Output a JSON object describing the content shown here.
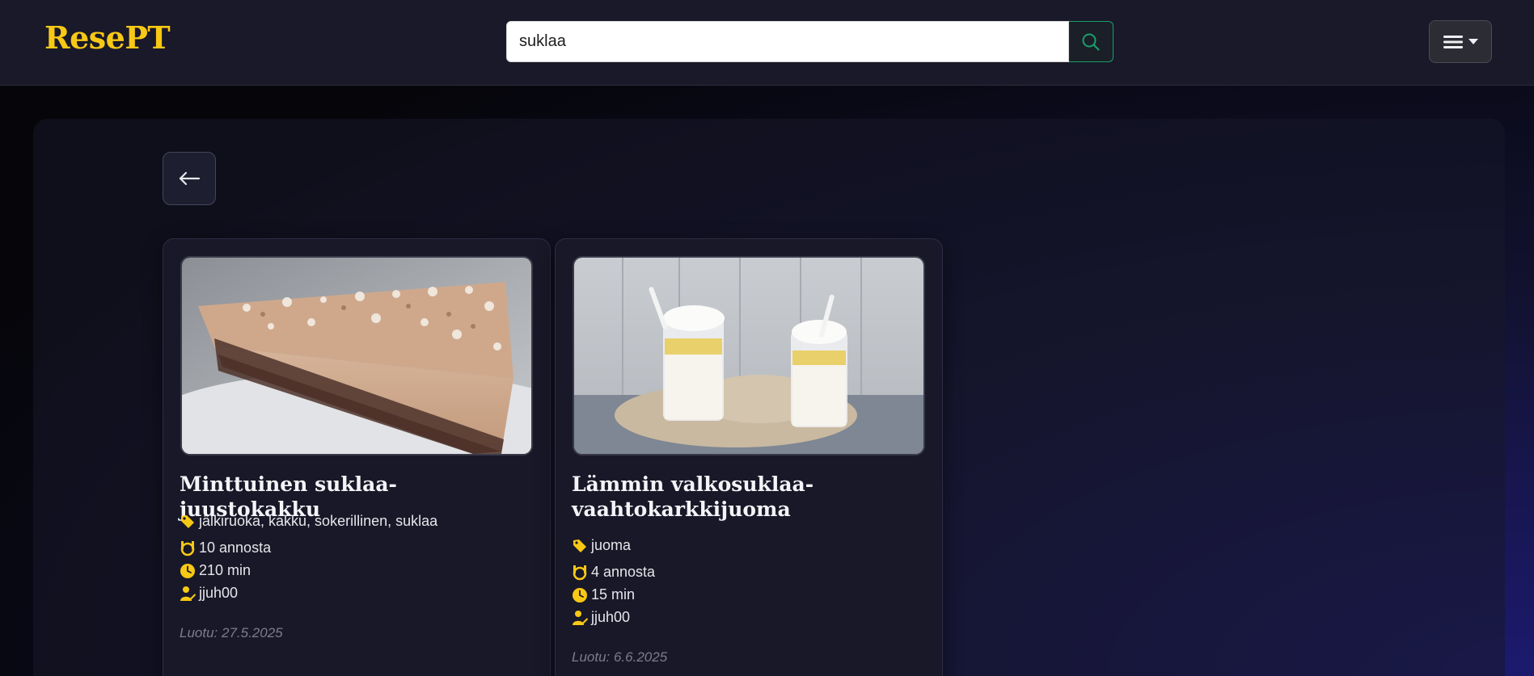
{
  "header": {
    "brand": "ResePT",
    "search": {
      "value": "suklaa",
      "icon": "search-icon"
    },
    "menu": {
      "icon": "hamburger-icon",
      "dropdown_icon": "caret-down-icon"
    }
  },
  "back_button": {
    "icon": "arrow-left-icon"
  },
  "recipes": [
    {
      "title": "Minttuinen suklaa-juustokakku",
      "tags": "jälkiruoka, kakku, sokerillinen, suklaa",
      "servings": "10 annosta",
      "time": "210 min",
      "author": "jjuh00",
      "created": "Luotu: 27.5.2025",
      "image": "chocolate-mint-cheesecake-slice"
    },
    {
      "title": "Lämmin valkosuklaa-vaahtokarkkijuoma",
      "tags": "juoma",
      "servings": "4 annosta",
      "time": "15 min",
      "author": "jjuh00",
      "created": "Luotu: 6.6.2025",
      "image": "white-chocolate-marshmallow-drinks"
    }
  ],
  "colors": {
    "accent": "#f7c815",
    "navbar": "#191929",
    "search_button_border": "#1a9e6a",
    "card_bg": "#181828"
  }
}
